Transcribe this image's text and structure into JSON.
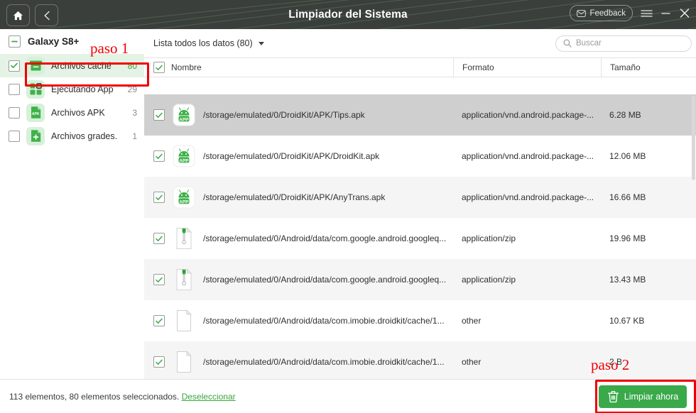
{
  "window": {
    "title": "Limpiador del Sistema",
    "home_icon": "home-icon",
    "back_icon": "back-chevron-icon",
    "feedback_label": "Feedback",
    "feedback_icon": "envelope-icon",
    "menu_icon": "hamburger-menu-icon",
    "minimize_icon": "minimize-icon",
    "close_icon": "close-icon",
    "titlebar_bg": "#3a3f3b"
  },
  "sidebar": {
    "device": "Galaxy S8+",
    "device_checkbox_state": "indeterminate",
    "items": [
      {
        "label": "Archivos caché",
        "count": "80",
        "icon": "cache-box-icon",
        "checked": true,
        "selected": true
      },
      {
        "label": "Ejecutando App",
        "count": "29",
        "icon": "running-apps-icon",
        "checked": false,
        "selected": false
      },
      {
        "label": "Archivos APK",
        "count": "3",
        "icon": "apk-file-icon",
        "checked": false,
        "selected": false
      },
      {
        "label": "Archivos grades.",
        "count": "1",
        "icon": "large-file-icon",
        "checked": false,
        "selected": false
      }
    ]
  },
  "toolbar": {
    "filter_label": "Lista todos los datos (80)",
    "filter_caret": "chevron-down-icon",
    "search_placeholder": "Buscar",
    "search_value": "",
    "search_icon": "search-icon"
  },
  "table": {
    "headers": {
      "name": "Nombre",
      "format": "Formato",
      "size": "Tamaño"
    },
    "header_checkbox_checked": true,
    "rows": [
      {
        "checked": true,
        "icon": "android-apk-icon",
        "path": "/storage/emulated/0/DroidKit/APK/Tips.apk",
        "format": "application/vnd.android.package-...",
        "size": "6.28 MB",
        "highlight": true
      },
      {
        "checked": true,
        "icon": "android-apk-icon",
        "path": "/storage/emulated/0/DroidKit/APK/DroidKit.apk",
        "format": "application/vnd.android.package-...",
        "size": "12.06 MB",
        "highlight": false
      },
      {
        "checked": true,
        "icon": "android-apk-icon",
        "path": "/storage/emulated/0/DroidKit/APK/AnyTrans.apk",
        "format": "application/vnd.android.package-...",
        "size": "16.66 MB",
        "highlight": false
      },
      {
        "checked": true,
        "icon": "zip-file-icon",
        "path": "/storage/emulated/0/Android/data/com.google.android.googleq...",
        "format": "application/zip",
        "size": "19.96 MB",
        "highlight": false
      },
      {
        "checked": true,
        "icon": "zip-file-icon",
        "path": "/storage/emulated/0/Android/data/com.google.android.googleq...",
        "format": "application/zip",
        "size": "13.43 MB",
        "highlight": false
      },
      {
        "checked": true,
        "icon": "generic-file-icon",
        "path": "/storage/emulated/0/Android/data/com.imobie.droidkit/cache/1...",
        "format": "other",
        "size": "10.67 KB",
        "highlight": false
      },
      {
        "checked": true,
        "icon": "generic-file-icon",
        "path": "/storage/emulated/0/Android/data/com.imobie.droidkit/cache/1...",
        "format": "other",
        "size": "2 B",
        "highlight": false
      }
    ]
  },
  "bottom": {
    "status_text": "113 elementos, 80 elementos seleccionados.",
    "deselect_label": "Deseleccionar",
    "clean_label": "Limpiar ahora",
    "clean_icon": "trash-can-icon",
    "clean_color": "#3aa94a"
  },
  "annotations": {
    "step1": "paso 1",
    "step2": "paso 2",
    "color": "#ef0000"
  }
}
